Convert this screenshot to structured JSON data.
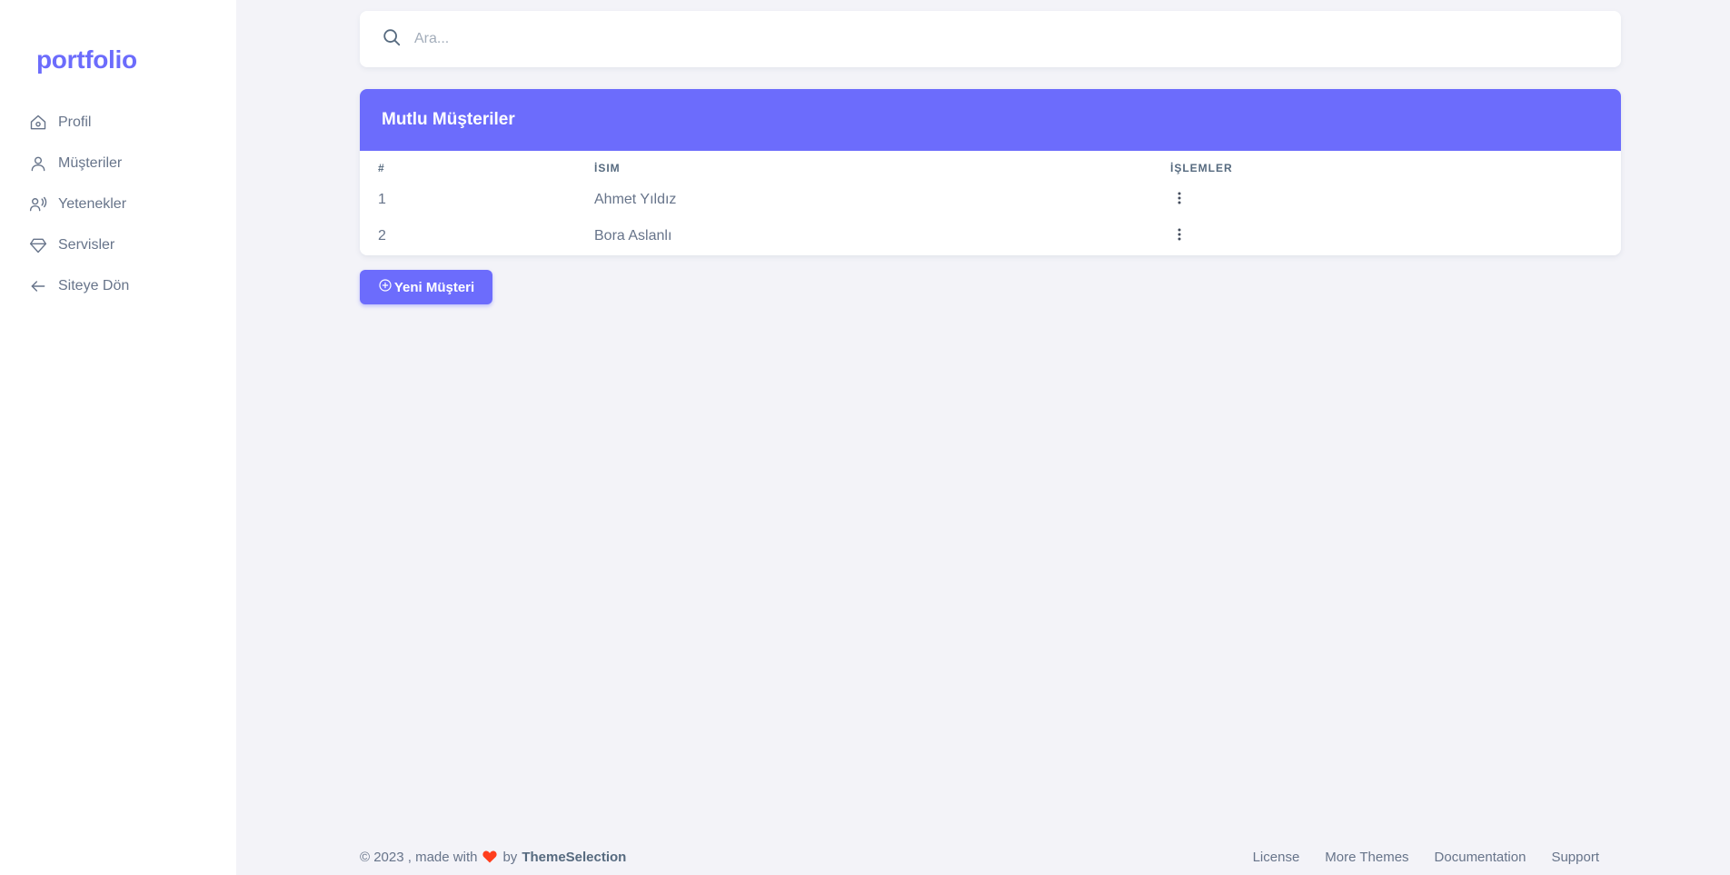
{
  "brand": "portfolio",
  "sidebar": {
    "items": [
      {
        "label": "Profil",
        "icon": "home-icon"
      },
      {
        "label": "Müşteriler",
        "icon": "user-icon"
      },
      {
        "label": "Yetenekler",
        "icon": "user-voice-icon"
      },
      {
        "label": "Servisler",
        "icon": "diamond-icon"
      },
      {
        "label": "Siteye Dön",
        "icon": "arrow-left-icon"
      }
    ]
  },
  "search": {
    "placeholder": "Ara..."
  },
  "card": {
    "title": "Mutlu Müşteriler",
    "columns": [
      "#",
      "İSIM",
      "İŞLEMLER"
    ],
    "rows": [
      {
        "num": "1",
        "name": "Ahmet Yıldız"
      },
      {
        "num": "2",
        "name": "Bora Aslanlı"
      }
    ]
  },
  "new_button": {
    "label": "Yeni Müşteri"
  },
  "footer": {
    "copyright": "© 2023 , made with",
    "by": "by",
    "author": "ThemeSelection",
    "links": [
      "License",
      "More Themes",
      "Documentation",
      "Support"
    ]
  },
  "colors": {
    "accent": "#6c6cfc",
    "background": "#f3f3f8",
    "heart": "#ff3e1d"
  }
}
